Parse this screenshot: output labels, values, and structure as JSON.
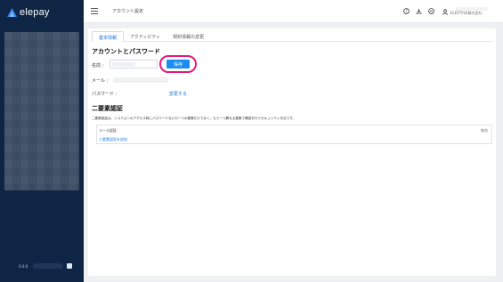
{
  "brand": {
    "name": "elepay",
    "logo_icon": "triangle-logo-icon",
    "accent": "#1a73e8"
  },
  "sidebar": {
    "version": "0.0.0"
  },
  "topbar": {
    "menu_icon": "hamburger-icon",
    "title": "アカウント設定",
    "icons": [
      "help-icon",
      "download-icon",
      "minus-circle-icon",
      "user-icon"
    ],
    "company": "ELESTYLE株式会社"
  },
  "tabs": [
    {
      "label": "基本情報",
      "active": true
    },
    {
      "label": "アクティビティ",
      "active": false
    },
    {
      "label": "契約情報の変更",
      "active": false
    }
  ],
  "account": {
    "title": "アカウントとパスワード",
    "name_label": "名前 :",
    "save_label": "保存",
    "mail_label": "メール :",
    "password_label": "パスワード :",
    "change_link": "変更する"
  },
  "twofa": {
    "title": "二要素認証",
    "description": "二要素認証は、システムへのアクセス時にパスワードなどの一つの要素だけでなく、もう一つ異なる要素で確認を行うセキュリティ手法です。",
    "mail_auth_label": "メール認証",
    "status": "無効",
    "add_link": "二要素認証を追加"
  },
  "colors": {
    "sidebar_bg": "#0f2545",
    "highlight_ring": "#e6197a",
    "button": "#1a8ef0"
  }
}
